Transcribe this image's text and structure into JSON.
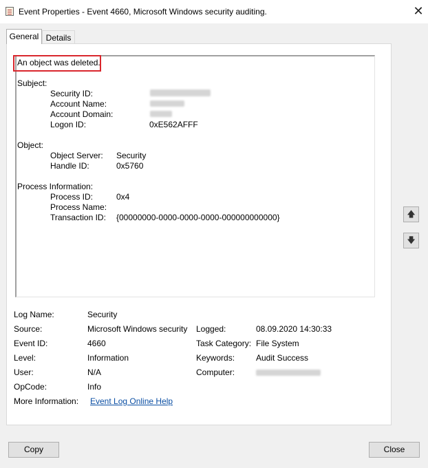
{
  "window": {
    "title": "Event Properties - Event 4660, Microsoft Windows security auditing.",
    "close_glyph": "✕",
    "icon": "event-viewer-icon"
  },
  "tabs": [
    {
      "label": "General",
      "selected": true
    },
    {
      "label": "Details",
      "selected": false
    }
  ],
  "description": {
    "headline": "An object was deleted.",
    "subject_header": "Subject:",
    "subject": {
      "security_id_label": "Security ID:",
      "account_name_label": "Account Name:",
      "account_domain_label": "Account Domain:",
      "logon_id_label": "Logon ID:",
      "logon_id_value": "0xE562AFFF"
    },
    "object_header": "Object:",
    "object": {
      "object_server_label": "Object Server:",
      "object_server_value": "Security",
      "handle_id_label": "Handle ID:",
      "handle_id_value": "0x5760"
    },
    "process_header": "Process Information:",
    "process": {
      "process_id_label": "Process ID:",
      "process_id_value": "0x4",
      "process_name_label": "Process Name:",
      "transaction_id_label": "Transaction ID:",
      "transaction_id_value": "{00000000-0000-0000-0000-000000000000}"
    }
  },
  "details": {
    "log_name_label": "Log Name:",
    "log_name_value": "Security",
    "source_label": "Source:",
    "source_value": "Microsoft Windows security",
    "logged_label": "Logged:",
    "logged_value": "08.09.2020 14:30:33",
    "event_id_label": "Event ID:",
    "event_id_value": "4660",
    "task_category_label": "Task Category:",
    "task_category_value": "File System",
    "level_label": "Level:",
    "level_value": "Information",
    "keywords_label": "Keywords:",
    "keywords_value": "Audit Success",
    "user_label": "User:",
    "user_value": "N/A",
    "computer_label": "Computer:",
    "opcode_label": "OpCode:",
    "opcode_value": "Info",
    "more_info_label": "More Information:",
    "more_info_link": "Event Log Online Help"
  },
  "scroll": {
    "up_glyph": "🡅",
    "down_glyph": "🡇"
  },
  "buttons": {
    "copy": "Copy",
    "close": "Close"
  },
  "colors": {
    "highlight_border": "#d9262c",
    "link": "#0a4ea3"
  }
}
